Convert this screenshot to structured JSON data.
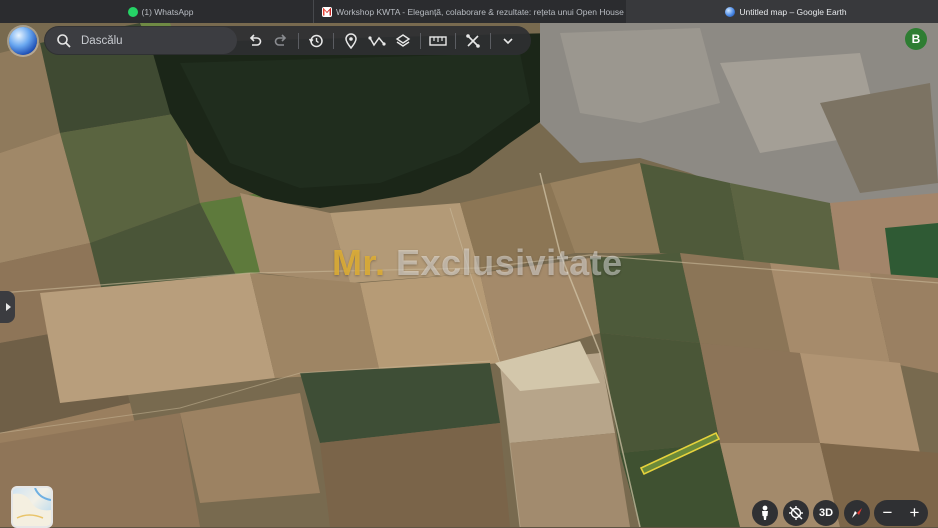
{
  "browser": {
    "tabs": [
      {
        "title": "(1) WhatsApp",
        "icon": "whatsapp-icon"
      },
      {
        "title": "Workshop KWTA - Eleganță, colaborare & rezultate: rețeta unui Open House de to...",
        "icon": "gmail-icon"
      },
      {
        "title": "Untitled map – Google Earth",
        "icon": "google-earth-icon",
        "active": true
      }
    ]
  },
  "toolbar": {
    "search_placeholder": "Dascălu",
    "icons": [
      "search-icon",
      "undo-icon",
      "redo-icon",
      "history-icon",
      "placemark-icon",
      "path-icon",
      "layers-icon",
      "ruler-icon",
      "measure-tools-icon",
      "chevron-down-icon"
    ]
  },
  "user": {
    "avatar_letter": "B",
    "avatar_color": "#2e7d32"
  },
  "watermark": {
    "part1": "Mr.",
    "part2": " Exclusivitate"
  },
  "controls": {
    "view_mode": "3D",
    "zoom_out": "−",
    "zoom_in": "+"
  },
  "map": {
    "highlight_color": "#e6d23c",
    "icons": [
      "pegman-icon",
      "compass-icon",
      "location-icon"
    ]
  }
}
